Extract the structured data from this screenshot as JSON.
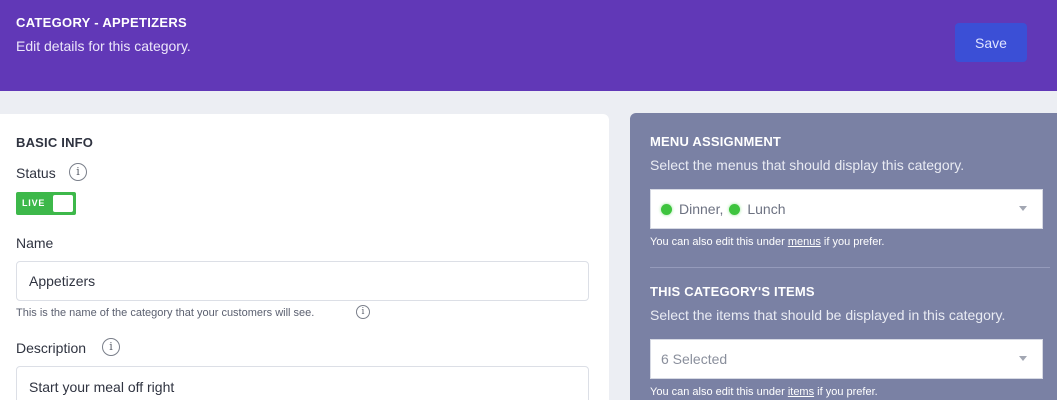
{
  "header": {
    "title": "CATEGORY - APPETIZERS",
    "subtitle": "Edit details for this category.",
    "save_label": "Save"
  },
  "basic_info": {
    "heading": "BASIC INFO",
    "status_label": "Status",
    "status_toggle": "LIVE",
    "name_label": "Name",
    "name_value": "Appetizers",
    "name_hint": "This is the name of the category that your customers will see.",
    "description_label": "Description",
    "description_value": "Start your meal off right"
  },
  "menu_assignment": {
    "heading": "MENU ASSIGNMENT",
    "subtitle": "Select the menus that should display this category.",
    "selected": [
      "Dinner,",
      "Lunch"
    ],
    "hint_prefix": "You can also edit this under ",
    "hint_link": "menus",
    "hint_suffix": " if you prefer."
  },
  "category_items": {
    "heading": "THIS CATEGORY'S ITEMS",
    "subtitle": "Select the items that should be displayed in this category.",
    "selected_text": "6 Selected",
    "hint_prefix": "You can also edit this under ",
    "hint_link": "items",
    "hint_suffix": " if you prefer."
  },
  "colors": {
    "header_bg": "#6138b7",
    "save_button": "#3b4fd6",
    "toggle_live": "#3db84a",
    "right_panel_bg": "#7a81a4",
    "status_dot": "#3ec43e"
  },
  "icons": [
    "info-icon",
    "chevron-down-icon",
    "status-dot-icon"
  ]
}
